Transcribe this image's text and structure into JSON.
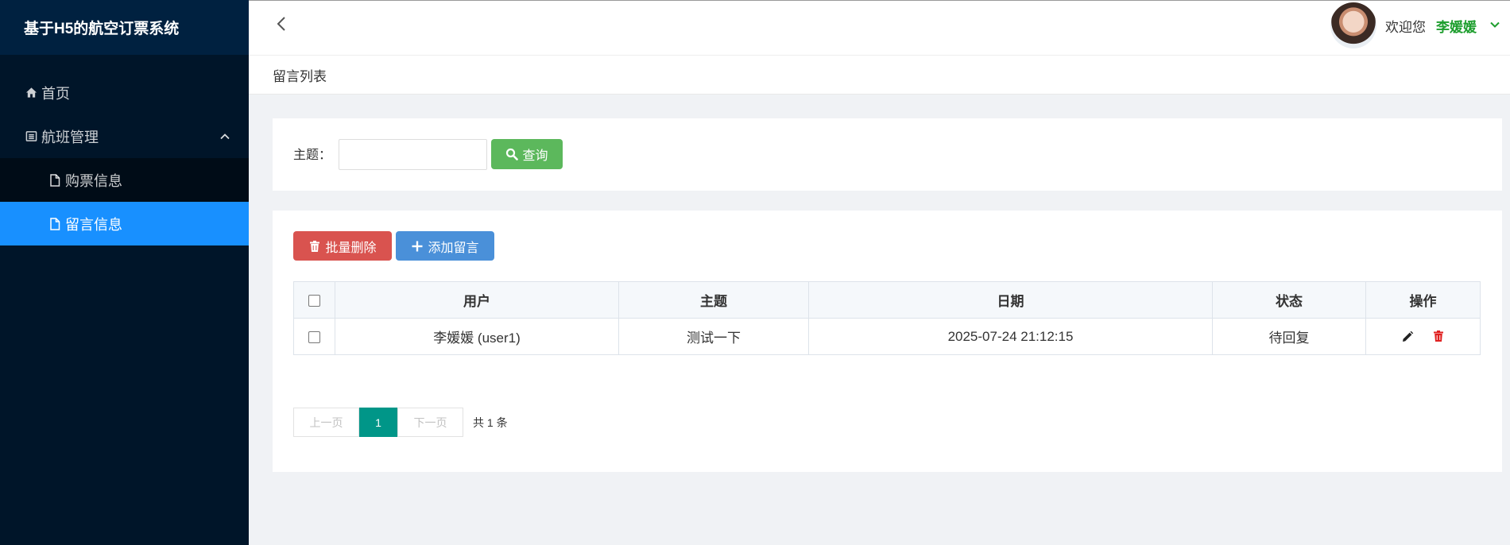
{
  "app": {
    "title": "基于H5的航空订票系统"
  },
  "sidebar": {
    "items": [
      {
        "label": "首页",
        "icon": "home-icon"
      },
      {
        "label": "航班管理",
        "icon": "list-icon",
        "expanded": true,
        "children": [
          {
            "label": "购票信息",
            "icon": "file-icon",
            "active": false
          },
          {
            "label": "留言信息",
            "icon": "file-icon",
            "active": true
          }
        ]
      }
    ]
  },
  "header": {
    "welcome": "欢迎您",
    "username": "李媛媛"
  },
  "breadcrumb": {
    "current": "留言列表"
  },
  "search": {
    "label": "主题：",
    "value": "",
    "placeholder": "",
    "button_label": "查询"
  },
  "toolbar": {
    "delete_label": "批量删除",
    "add_label": "添加留言"
  },
  "table": {
    "columns": [
      "用户",
      "主题",
      "日期",
      "状态",
      "操作"
    ],
    "rows": [
      {
        "user": "李媛媛 (user1)",
        "subject": "测试一下",
        "date": "2025-07-24 21:12:15",
        "status": "待回复"
      }
    ]
  },
  "pagination": {
    "prev": "上一页",
    "current": "1",
    "next": "下一页",
    "total": "共 1 条"
  },
  "colors": {
    "sidebar_bg": "#001529",
    "active_menu": "#1890ff",
    "search_button": "#5cb85c",
    "delete_button": "#d9534f",
    "add_button": "#4a90d9",
    "username": "#1e9e2e",
    "pager_active": "#009688"
  }
}
